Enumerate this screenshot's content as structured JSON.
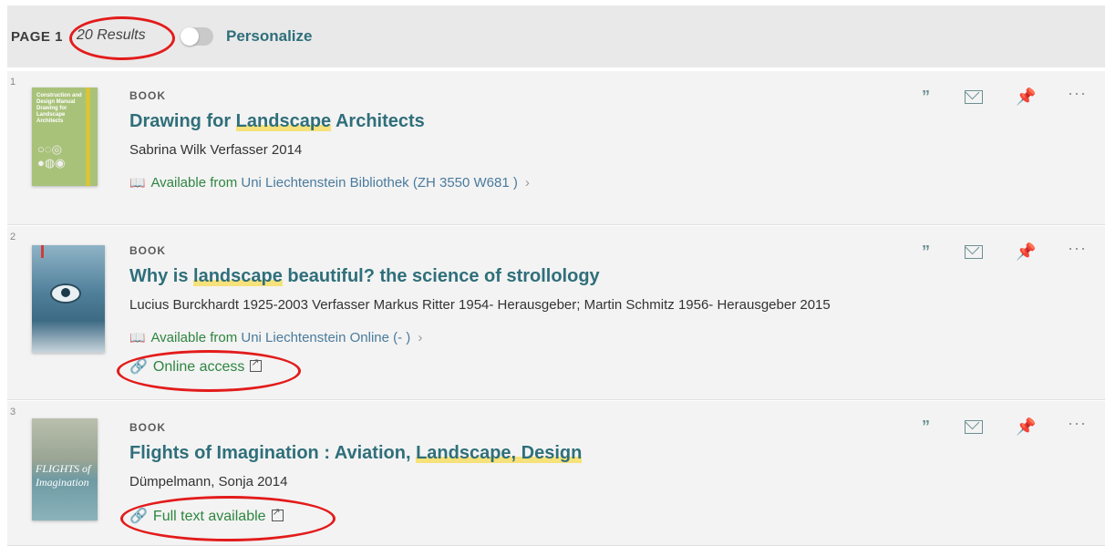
{
  "header": {
    "page_label": "PAGE 1",
    "results_count": "20 Results",
    "personalize_label": "Personalize"
  },
  "colors": {
    "title": "#2f6f7a",
    "available": "#2e8540",
    "highlight": "#f6e17a",
    "pin": "#1aa5a6",
    "annotation_ring": "#e31b1b"
  },
  "actions": {
    "cite_icon": "quote-icon",
    "email_icon": "mail-icon",
    "pin_icon": "pin-icon",
    "more_icon": "more-icon",
    "cite_glyph": "”",
    "more_glyph": "···",
    "pin_glyph": "📌"
  },
  "results": [
    {
      "index": "1",
      "type": "BOOK",
      "title_before": "Drawing for ",
      "title_highlight": "Landscape",
      "title_after": " Architects",
      "authors": "Sabrina Wilk Verfasser 2014",
      "availability_status": "Available from",
      "availability_location": " Uni Liechtenstein  Bibliothek (ZH 3550 W681 )",
      "thumb_text": "Construction and Design Manual Drawing for Landscape Architects"
    },
    {
      "index": "2",
      "type": "BOOK",
      "title_before": "Why is ",
      "title_highlight": "landscape",
      "title_after": " beautiful? the science of strollology",
      "authors": "Lucius Burckhardt 1925-2003 Verfasser Markus Ritter 1954- Herausgeber; Martin Schmitz 1956- Herausgeber 2015",
      "availability_status": "Available from",
      "availability_location": " Uni Liechtenstein  Online (- )",
      "link_label": "Online access"
    },
    {
      "index": "3",
      "type": "BOOK",
      "title_before": "Flights of Imagination : Aviation, ",
      "title_highlight": "Landscape, Design",
      "title_after": "",
      "authors": "Dümpelmann, Sonja 2014",
      "link_label": "Full text available",
      "thumb_text": "FLIGHTS of Imagination"
    }
  ]
}
